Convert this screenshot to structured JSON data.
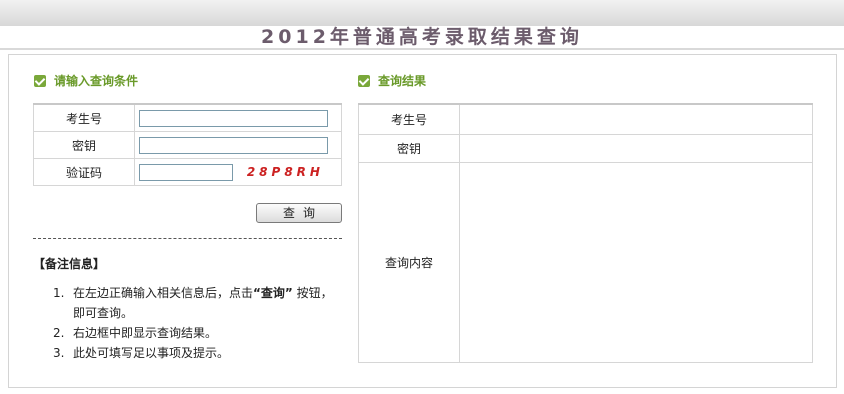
{
  "page": {
    "title": "2012年普通高考录取结果查询"
  },
  "query_section": {
    "heading": "请输入查询条件",
    "fields": [
      {
        "label": "考生号",
        "value": ""
      },
      {
        "label": "密钥",
        "value": ""
      },
      {
        "label": "验证码",
        "value": "",
        "captcha": "28P8RH"
      }
    ],
    "submit_label": "查询"
  },
  "notes": {
    "title": "【备注信息】",
    "items": [
      {
        "num": "1.",
        "text_before": "在左边正确输入相关信息后，点击",
        "bold": "“查询”",
        "text_after": "按钮，",
        "line2": "即可查询。"
      },
      {
        "num": "2.",
        "text": "右边框中即显示查询结果。"
      },
      {
        "num": "3.",
        "text": "此处可填写足以事项及提示。"
      }
    ]
  },
  "result_section": {
    "heading": "查询结果",
    "rows": [
      {
        "label": "考生号",
        "value": ""
      },
      {
        "label": "密钥",
        "value": ""
      },
      {
        "label": "查询内容",
        "value": ""
      }
    ]
  },
  "colors": {
    "accent_green": "#6a9a2a",
    "captcha_red": "#cc2222",
    "title_purple": "#6c5c6c"
  },
  "icons": {
    "section_check": "check-square-icon"
  }
}
